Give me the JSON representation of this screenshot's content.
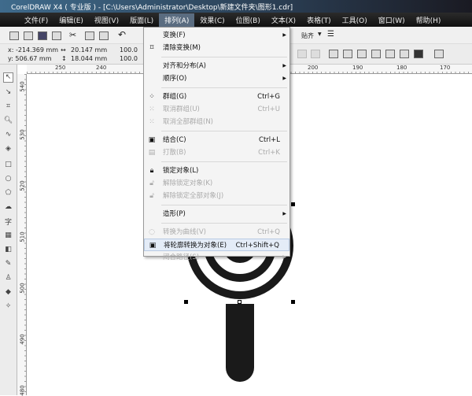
{
  "window": {
    "title": "CorelDRAW X4 ( 专业版 ) - [C:\\Users\\Administrator\\Desktop\\新建文件夹\\图形1.cdr]"
  },
  "menubar": [
    {
      "label": "文件(F)"
    },
    {
      "label": "编辑(E)"
    },
    {
      "label": "视图(V)"
    },
    {
      "label": "版面(L)"
    },
    {
      "label": "排列(A)",
      "active": true
    },
    {
      "label": "效果(C)"
    },
    {
      "label": "位图(B)"
    },
    {
      "label": "文本(X)"
    },
    {
      "label": "表格(T)"
    },
    {
      "label": "工具(O)"
    },
    {
      "label": "窗口(W)"
    },
    {
      "label": "帮助(H)"
    }
  ],
  "toolbar": {
    "snap_label": "贴齐"
  },
  "property_bar": {
    "x": "x: -214.369 mm",
    "y": "y: 506.67 mm",
    "width": "20.147 mm",
    "height": "18.044 mm",
    "scale_x": "100.0",
    "scale_y": "100.0"
  },
  "rulers": {
    "horizontal": [
      "250",
      "240",
      "200",
      "190",
      "180",
      "170"
    ],
    "vertical": [
      "540",
      "530",
      "520",
      "510",
      "500",
      "490",
      "480"
    ]
  },
  "arrange_menu": [
    {
      "label": "变换(F)",
      "submenu": true,
      "icon": ""
    },
    {
      "label": "清除变换(M)",
      "icon": "clear-transform-icon"
    },
    {
      "sep": true
    },
    {
      "label": "对齐和分布(A)",
      "submenu": true
    },
    {
      "label": "顺序(O)",
      "submenu": true
    },
    {
      "sep": true
    },
    {
      "label": "群组(G)",
      "shortcut": "Ctrl+G",
      "icon": "group-icon"
    },
    {
      "label": "取消群组(U)",
      "shortcut": "Ctrl+U",
      "disabled": true,
      "icon": "ungroup-icon"
    },
    {
      "label": "取消全部群组(N)",
      "disabled": true,
      "icon": "ungroup-all-icon"
    },
    {
      "sep": true
    },
    {
      "label": "结合(C)",
      "shortcut": "Ctrl+L",
      "icon": "combine-icon"
    },
    {
      "label": "打散(B)",
      "shortcut": "Ctrl+K",
      "disabled": true,
      "icon": "break-apart-icon"
    },
    {
      "sep": true
    },
    {
      "label": "锁定对象(L)",
      "icon": "lock-icon"
    },
    {
      "label": "解除锁定对象(K)",
      "disabled": true,
      "icon": "unlock-icon"
    },
    {
      "label": "解除锁定全部对象(J)",
      "disabled": true,
      "icon": "unlock-all-icon"
    },
    {
      "sep": true
    },
    {
      "label": "造形(P)",
      "submenu": true
    },
    {
      "sep": true
    },
    {
      "label": "转换为曲线(V)",
      "shortcut": "Ctrl+Q",
      "disabled": true,
      "icon": "convert-curves-icon"
    },
    {
      "label": "将轮廓转换为对象(E)",
      "shortcut": "Ctrl+Shift+Q",
      "highlighted": true,
      "icon": "outline-to-object-icon"
    },
    {
      "label": "闭合路径(S)",
      "submenu": true,
      "disabled": true
    }
  ]
}
